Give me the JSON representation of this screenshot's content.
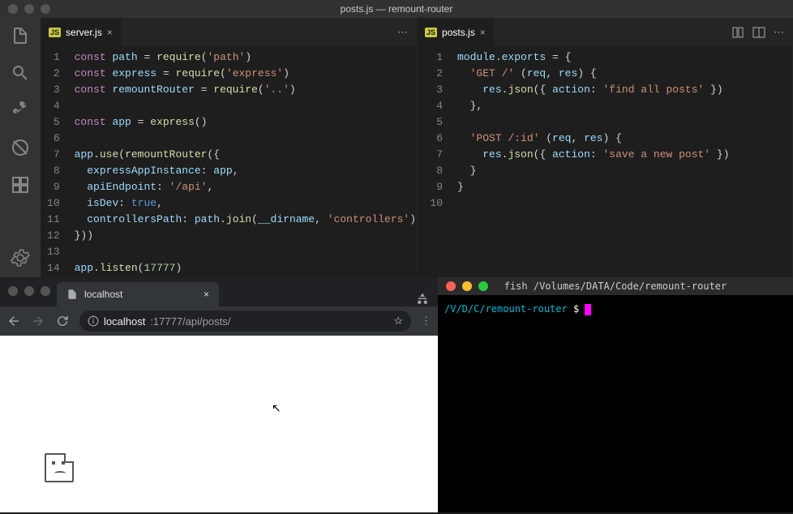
{
  "window": {
    "title": "posts.js — remount-router"
  },
  "editors": {
    "left": {
      "tab": "server.js",
      "gutter": [
        "1",
        "2",
        "3",
        "4",
        "5",
        "6",
        "7",
        "8",
        "9",
        "10",
        "11",
        "12",
        "13",
        "14"
      ],
      "lines": [
        [
          {
            "cls": "k",
            "t": "const"
          },
          {
            "cls": "p",
            "t": " "
          },
          {
            "cls": "v",
            "t": "path"
          },
          {
            "cls": "p",
            "t": " = "
          },
          {
            "cls": "fn",
            "t": "require"
          },
          {
            "cls": "p",
            "t": "("
          },
          {
            "cls": "s",
            "t": "'path'"
          },
          {
            "cls": "p",
            "t": ")"
          }
        ],
        [
          {
            "cls": "k",
            "t": "const"
          },
          {
            "cls": "p",
            "t": " "
          },
          {
            "cls": "v",
            "t": "express"
          },
          {
            "cls": "p",
            "t": " = "
          },
          {
            "cls": "fn",
            "t": "require"
          },
          {
            "cls": "p",
            "t": "("
          },
          {
            "cls": "s",
            "t": "'express'"
          },
          {
            "cls": "p",
            "t": ")"
          }
        ],
        [
          {
            "cls": "k",
            "t": "const"
          },
          {
            "cls": "p",
            "t": " "
          },
          {
            "cls": "v",
            "t": "remountRouter"
          },
          {
            "cls": "p",
            "t": " = "
          },
          {
            "cls": "fn",
            "t": "require"
          },
          {
            "cls": "p",
            "t": "("
          },
          {
            "cls": "s",
            "t": "'..'"
          },
          {
            "cls": "p",
            "t": ")"
          }
        ],
        [],
        [
          {
            "cls": "k",
            "t": "const"
          },
          {
            "cls": "p",
            "t": " "
          },
          {
            "cls": "v",
            "t": "app"
          },
          {
            "cls": "p",
            "t": " = "
          },
          {
            "cls": "fn",
            "t": "express"
          },
          {
            "cls": "p",
            "t": "()"
          }
        ],
        [],
        [
          {
            "cls": "v",
            "t": "app"
          },
          {
            "cls": "p",
            "t": "."
          },
          {
            "cls": "fn",
            "t": "use"
          },
          {
            "cls": "p",
            "t": "("
          },
          {
            "cls": "fn",
            "t": "remountRouter"
          },
          {
            "cls": "p",
            "t": "({"
          }
        ],
        [
          {
            "cls": "p",
            "t": "  "
          },
          {
            "cls": "v",
            "t": "expressAppInstance"
          },
          {
            "cls": "p",
            "t": ": "
          },
          {
            "cls": "v",
            "t": "app"
          },
          {
            "cls": "p",
            "t": ","
          }
        ],
        [
          {
            "cls": "p",
            "t": "  "
          },
          {
            "cls": "v",
            "t": "apiEndpoint"
          },
          {
            "cls": "p",
            "t": ": "
          },
          {
            "cls": "s",
            "t": "'/api'"
          },
          {
            "cls": "p",
            "t": ","
          }
        ],
        [
          {
            "cls": "p",
            "t": "  "
          },
          {
            "cls": "v",
            "t": "isDev"
          },
          {
            "cls": "p",
            "t": ": "
          },
          {
            "cls": "c",
            "t": "true"
          },
          {
            "cls": "p",
            "t": ","
          }
        ],
        [
          {
            "cls": "p",
            "t": "  "
          },
          {
            "cls": "v",
            "t": "controllersPath"
          },
          {
            "cls": "p",
            "t": ": "
          },
          {
            "cls": "v",
            "t": "path"
          },
          {
            "cls": "p",
            "t": "."
          },
          {
            "cls": "fn",
            "t": "join"
          },
          {
            "cls": "p",
            "t": "("
          },
          {
            "cls": "v",
            "t": "__dirname"
          },
          {
            "cls": "p",
            "t": ", "
          },
          {
            "cls": "s",
            "t": "'controllers'"
          },
          {
            "cls": "p",
            "t": ")"
          }
        ],
        [
          {
            "cls": "p",
            "t": "}))"
          }
        ],
        [],
        [
          {
            "cls": "v",
            "t": "app"
          },
          {
            "cls": "p",
            "t": "."
          },
          {
            "cls": "fn",
            "t": "listen"
          },
          {
            "cls": "p",
            "t": "("
          },
          {
            "cls": "n",
            "t": "17777"
          },
          {
            "cls": "p",
            "t": ")"
          }
        ]
      ]
    },
    "right": {
      "tab": "posts.js",
      "gutter": [
        "1",
        "2",
        "3",
        "4",
        "5",
        "6",
        "7",
        "8",
        "9",
        "10"
      ],
      "lines": [
        [
          {
            "cls": "v",
            "t": "module"
          },
          {
            "cls": "p",
            "t": "."
          },
          {
            "cls": "v",
            "t": "exports"
          },
          {
            "cls": "p",
            "t": " = {"
          }
        ],
        [
          {
            "cls": "p",
            "t": "  "
          },
          {
            "cls": "s",
            "t": "'GET /'"
          },
          {
            "cls": "p",
            "t": " ("
          },
          {
            "cls": "v",
            "t": "req"
          },
          {
            "cls": "p",
            "t": ", "
          },
          {
            "cls": "v",
            "t": "res"
          },
          {
            "cls": "p",
            "t": ") {"
          }
        ],
        [
          {
            "cls": "p",
            "t": "    "
          },
          {
            "cls": "v",
            "t": "res"
          },
          {
            "cls": "p",
            "t": "."
          },
          {
            "cls": "fn",
            "t": "json"
          },
          {
            "cls": "p",
            "t": "({ "
          },
          {
            "cls": "v",
            "t": "action"
          },
          {
            "cls": "p",
            "t": ": "
          },
          {
            "cls": "s",
            "t": "'find all posts'"
          },
          {
            "cls": "p",
            "t": " })"
          }
        ],
        [
          {
            "cls": "p",
            "t": "  },"
          }
        ],
        [],
        [
          {
            "cls": "p",
            "t": "  "
          },
          {
            "cls": "s",
            "t": "'POST /:id'"
          },
          {
            "cls": "p",
            "t": " ("
          },
          {
            "cls": "v",
            "t": "req"
          },
          {
            "cls": "p",
            "t": ", "
          },
          {
            "cls": "v",
            "t": "res"
          },
          {
            "cls": "p",
            "t": ") {"
          }
        ],
        [
          {
            "cls": "p",
            "t": "    "
          },
          {
            "cls": "v",
            "t": "res"
          },
          {
            "cls": "p",
            "t": "."
          },
          {
            "cls": "fn",
            "t": "json"
          },
          {
            "cls": "p",
            "t": "({ "
          },
          {
            "cls": "v",
            "t": "action"
          },
          {
            "cls": "p",
            "t": ": "
          },
          {
            "cls": "s",
            "t": "'save a new post'"
          },
          {
            "cls": "p",
            "t": " })"
          }
        ],
        [
          {
            "cls": "p",
            "t": "  }"
          }
        ],
        [
          {
            "cls": "p",
            "t": "}"
          }
        ],
        []
      ]
    }
  },
  "browser": {
    "tab_title": "localhost",
    "url_host": "localhost",
    "url_path": ":17777/api/posts/"
  },
  "terminal": {
    "title": "fish /Volumes/DATA/Code/remount-router",
    "prompt_path": "/V/D/C/remount-router",
    "prompt_symbol": " $ "
  },
  "icons": {
    "js": "JS",
    "dots": "⋯",
    "close": "×",
    "star": "☆"
  }
}
